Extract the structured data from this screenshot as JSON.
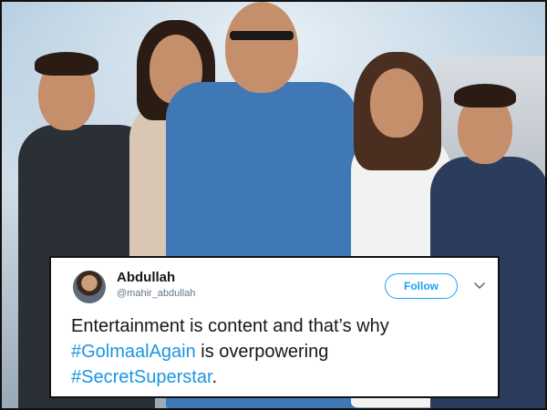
{
  "tweet": {
    "author": {
      "name": "Abdullah",
      "handle": "@mahir_abdullah"
    },
    "follow_label": "Follow",
    "text_part1": "Entertainment is content and that’s why",
    "hashtag1": "#GolmaalAgain",
    "text_part2": " is overpowering",
    "hashtag2": "#SecretSuperstar",
    "text_part3": "."
  },
  "icons": {
    "menu": "chevron-down-icon"
  },
  "colors": {
    "link": "#1b95e0",
    "follow": "#1da1f2",
    "text": "#14171a",
    "secondary": "#657786"
  }
}
